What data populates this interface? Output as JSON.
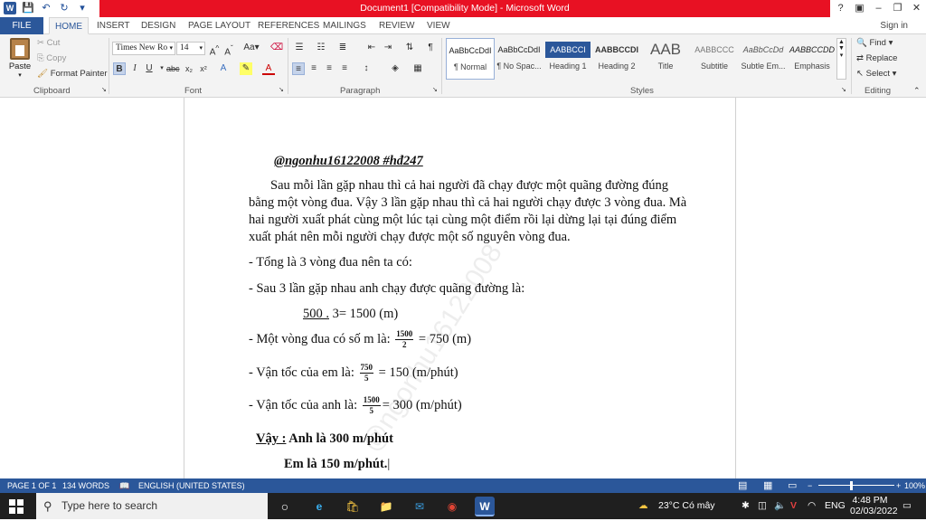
{
  "titlebar": {
    "title": "Document1 [Compatibility Mode] - Microsoft Word",
    "help": "?",
    "minimize": "–",
    "restore": "❐",
    "close": "✕"
  },
  "tabs": {
    "file": "FILE",
    "items": [
      "HOME",
      "INSERT",
      "DESIGN",
      "PAGE LAYOUT",
      "REFERENCES",
      "MAILINGS",
      "REVIEW",
      "VIEW"
    ],
    "signin": "Sign in"
  },
  "clipboard": {
    "paste": "Paste",
    "cut": "Cut",
    "copy": "Copy",
    "format_painter": "Format Painter",
    "label": "Clipboard"
  },
  "font": {
    "name": "Times New Ro",
    "size": "14",
    "label": "Font"
  },
  "paragraph": {
    "label": "Paragraph"
  },
  "styles": {
    "label": "Styles",
    "items": [
      {
        "preview": "AaBbCcDdI",
        "name": "¶ Normal"
      },
      {
        "preview": "AaBbCcDdI",
        "name": "¶ No Spac..."
      },
      {
        "preview": "AABBCCI",
        "name": "Heading 1"
      },
      {
        "preview": "AABBCCDI",
        "name": "Heading 2"
      },
      {
        "preview": "AAB",
        "name": "Title"
      },
      {
        "preview": "AABBCCC",
        "name": "Subtitle"
      },
      {
        "preview": "AaBbCcDd",
        "name": "Subtle Em..."
      },
      {
        "preview": "AABBCCDD",
        "name": "Emphasis"
      }
    ]
  },
  "editing": {
    "find": "Find",
    "replace": "Replace",
    "select": "Select",
    "label": "Editing"
  },
  "document": {
    "header": "@ngonhu16122008  #hđ247",
    "para1": [
      "Sau mỗi lần gặp nhau thì cả hai người đã chạy được một quãng đường đúng",
      "bằng một vòng đua. Vậy 3 lần gặp nhau thì cả hai người chạy được 3 vòng đua. Mà",
      "hai người xuất phát cùng một lúc tại cùng một điểm rồi lại dừng lại tại đúng điểm",
      "xuất phát nên mỗi người chạy được một số nguyên vòng đua."
    ],
    "line_total": "- Tổng là 3 vòng đua nên ta có:",
    "line_after3": "- Sau 3 lần gặp nhau anh chạy được quãng đường là:",
    "calc_a": "500 .",
    "calc_b": " 3= 1500 (m)",
    "lap_prefix": "- Một vòng đua có số m là: ",
    "lap_num": "1500",
    "lap_den": "2",
    "lap_suffix": " = 750 (m)",
    "em_prefix": "- Vận tốc của em là: ",
    "em_num": "750",
    "em_den": "5",
    "em_suffix": " = 150 (m/phút)",
    "anh_prefix": "- Vận tốc của anh là: ",
    "anh_num": "1500",
    "anh_den": "5",
    "anh_suffix": "= 300 (m/phút)",
    "conclusion_label": "Vậy :",
    "conclusion_a": " Anh là  300 m/phút",
    "conclusion_b": "Em là  150 m/phút.",
    "watermark": "@ngonhu16122008"
  },
  "statusbar": {
    "page": "PAGE 1 OF 1",
    "words": "134 WORDS",
    "language": "ENGLISH (UNITED STATES)",
    "zoom": "100%"
  },
  "taskbar": {
    "search_placeholder": "Type here to search",
    "weather": "23°C  Có mây",
    "language": "ENG",
    "time": "4:48 PM",
    "date": "02/03/2022"
  },
  "colors": {
    "title_red": "#e81123",
    "word_blue": "#2b579a",
    "taskbar": "#1f1f1f"
  }
}
